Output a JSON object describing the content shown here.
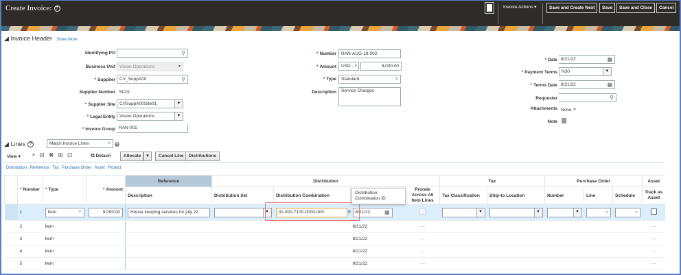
{
  "app": {
    "title": "Create Invoice:",
    "toolbar": {
      "invoice_actions": "Invoice Actions ▾",
      "save_create_next": "Save and Create Next",
      "save": "Save",
      "save_close": "Save and Close",
      "cancel": "Cancel"
    }
  },
  "header": {
    "section_title": "Invoice Header",
    "show_more": "Show More",
    "identifying_po": {
      "label": "Identifying PO",
      "value": ""
    },
    "business_unit": {
      "label": "Business Unit",
      "value": "Vision Operations"
    },
    "supplier": {
      "label": "Supplier",
      "value": "CV_SuppA00"
    },
    "supplier_number": {
      "label": "Supplier Number",
      "value": "5C01"
    },
    "supplier_site": {
      "label": "Supplier Site",
      "value": "CVSuppA00Site01"
    },
    "legal_entity": {
      "label": "Legal Entity",
      "value": "Vision Operations"
    },
    "invoice_group": {
      "label": "Invoice Group",
      "value": "RAN-001"
    },
    "number": {
      "label": "Number",
      "value": "RAN-AUG-19-002"
    },
    "amount": {
      "label": "Amount",
      "currency": "USD - ",
      "value": "9,000.00"
    },
    "type": {
      "label": "Type",
      "value": "Standard"
    },
    "description": {
      "label": "Description",
      "value": "Service Charges"
    },
    "date": {
      "label": "Date",
      "value": "8/21/22"
    },
    "payment_terms": {
      "label": "Payment Terms",
      "value": "N30"
    },
    "terms_date": {
      "label": "Terms Date",
      "value": "8/21/22"
    },
    "requester": {
      "label": "Requester",
      "value": ""
    },
    "attachments": {
      "label": "Attachments",
      "value": "None"
    },
    "note": {
      "label": "Note"
    }
  },
  "lines": {
    "title": "Lines",
    "match_select": "Match Invoice Lines",
    "view": "View ▾",
    "detach": "Detach",
    "allocate": "Allocate",
    "cancel_line": "Cancel Line",
    "distributions": "Distributions",
    "tabs": [
      "Distribution",
      "Reference",
      "Tax",
      "Purchase Order",
      "Asset",
      "Project"
    ],
    "groups": {
      "reference": "Reference",
      "distribution": "Distribution",
      "tax": "Tax",
      "purchase_order": "Purchase Order",
      "asset": "Asset"
    },
    "columns": {
      "number": "Number",
      "type": "Type",
      "amount": "Amount",
      "description": "Description",
      "distribution_set": "Distribution Set",
      "distribution_combination": "Distribution Combination",
      "prorate": "Prorate Across All Item Lines",
      "tax_classification": "Tax Classification",
      "ship_to": "Ship-to Location",
      "po_number": "Number",
      "line": "Line",
      "schedule": "Schedule",
      "track_asset": "Track as Asset"
    },
    "tooltip": "Distribution Combination ID",
    "rows": [
      {
        "number": "1",
        "type": "Item",
        "amount": "9,000.00",
        "description": "House keeping services for july 22",
        "distribution_combination": "01-000-7100-0000-000",
        "date": "8/21/22"
      },
      {
        "number": "2",
        "type": "Item",
        "date": "8/21/22"
      },
      {
        "number": "3",
        "type": "Item",
        "date": "8/21/22"
      },
      {
        "number": "4",
        "type": "Item",
        "date": "8/21/22"
      },
      {
        "number": "5",
        "type": "Item",
        "date": "8/21/22"
      }
    ]
  }
}
